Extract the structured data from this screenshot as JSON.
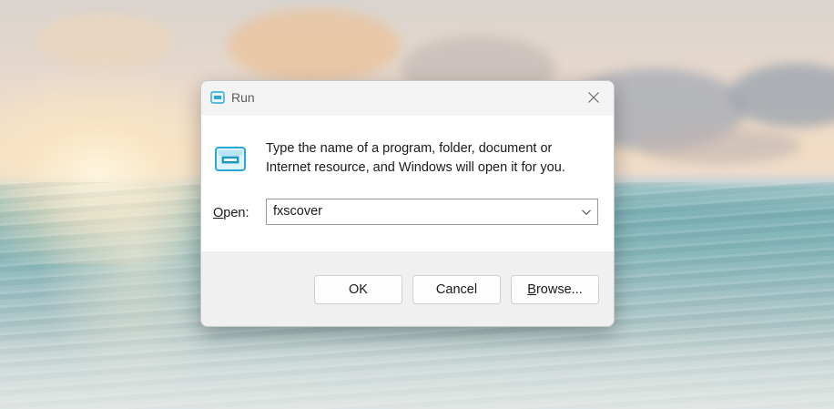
{
  "wallpaper": {
    "description_icon": "sea-sunset-wallpaper"
  },
  "dialog": {
    "title": "Run",
    "title_icon": "run-icon",
    "close_icon": "close-icon",
    "description_line1": "Type the name of a program, folder, document or",
    "description_line2": "Internet resource, and Windows will open it for you.",
    "open_label_mnemonic": "O",
    "open_label_rest": "pen:",
    "open_value": "fxscover",
    "dropdown_icon": "chevron-down-icon",
    "buttons": {
      "ok": "OK",
      "cancel": "Cancel",
      "browse_mnemonic": "B",
      "browse_rest": "rowse..."
    }
  },
  "colors": {
    "accent_icon": "#2aa9d6",
    "dialog_bg": "#f3f3f3",
    "body_bg": "#ffffff"
  }
}
